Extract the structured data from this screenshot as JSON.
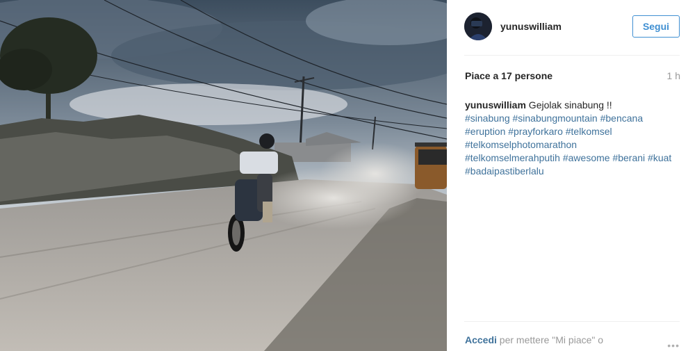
{
  "post": {
    "username": "yunuswilliam",
    "follow_label": "Segui",
    "likes": "Piace a 17 persone",
    "time": "1 h",
    "caption_user": "yunuswilliam",
    "caption_text": " Gejolak sinabung !!",
    "hashtags": "#sinabung #sinabungmountain #bencana #eruption #prayforkaro #telkomsel #telkomselphotomarathon #telkomselmerahputih #awesome #berani #kuat #badaipastiberlalu",
    "login_link": "Accedi",
    "login_text": " per mettere \"Mi piace\" o",
    "more_icon": "more-options-icon",
    "more_glyph": "•••"
  },
  "colors": {
    "follow": "#3f8fd2",
    "link": "#3f729b",
    "muted": "#999999"
  }
}
